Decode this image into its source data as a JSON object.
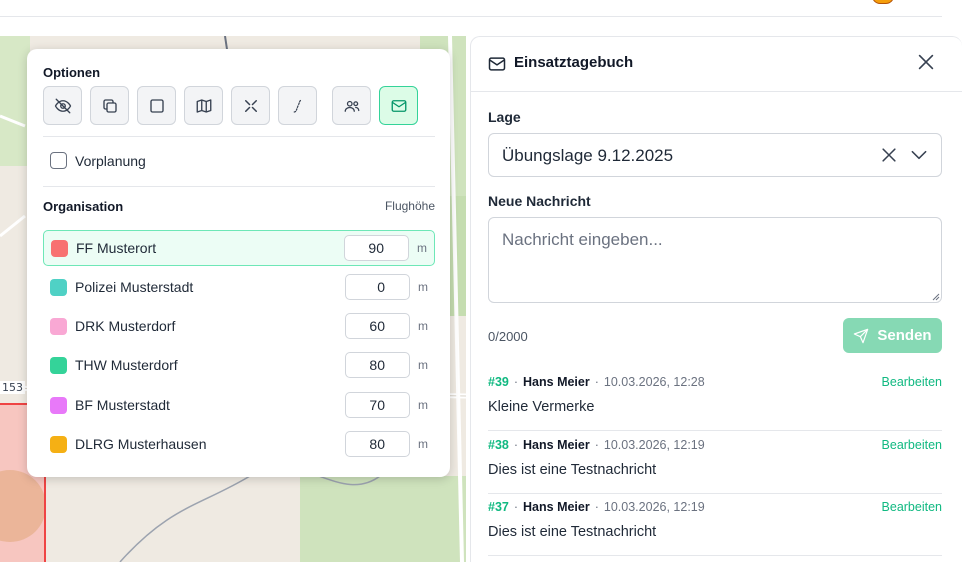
{
  "map": {
    "label": "153"
  },
  "options": {
    "title": "Optionen",
    "icons": [
      "eye-off-icon",
      "layers-icon",
      "square-icon",
      "map-icon",
      "crosshair-icon",
      "route-icon",
      "users-icon",
      "mail-icon"
    ],
    "active_icon": "mail-icon",
    "vorplanung_label": "Vorplanung",
    "vorplanung_checked": false,
    "org_title": "Organisation",
    "altitude_header": "Flughöhe",
    "unit": "m",
    "organizations": [
      {
        "name": "FF Musterort",
        "altitude": "90",
        "color": "#f87171",
        "selected": true
      },
      {
        "name": "Polizei Musterstadt",
        "altitude": "0",
        "color": "#4fd1c5",
        "selected": false
      },
      {
        "name": "DRK Musterdorf",
        "altitude": "60",
        "color": "#f9a8d4",
        "selected": false
      },
      {
        "name": "THW Musterdorf",
        "altitude": "80",
        "color": "#34d399",
        "selected": false
      },
      {
        "name": "BF Musterstadt",
        "altitude": "70",
        "color": "#e879f9",
        "selected": false
      },
      {
        "name": "DLRG Musterhausen",
        "altitude": "80",
        "color": "#f5b014",
        "selected": false
      }
    ]
  },
  "panel": {
    "title": "Einsatztagebuch",
    "lage_label": "Lage",
    "lage_value": "Übungslage 9.12.2025",
    "message_label": "Neue Nachricht",
    "message_placeholder": "Nachricht eingeben...",
    "counter": "0/2000",
    "send_label": "Senden",
    "accent": "#10b981",
    "messages": [
      {
        "num": "#39",
        "author": "Hans Meier",
        "time": "10.03.2026, 12:28",
        "edit": "Bearbeiten",
        "text": "Kleine Vermerke"
      },
      {
        "num": "#38",
        "author": "Hans Meier",
        "time": "10.03.2026, 12:19",
        "edit": "Bearbeiten",
        "text": "Dies ist eine Testnachricht"
      },
      {
        "num": "#37",
        "author": "Hans Meier",
        "time": "10.03.2026, 12:19",
        "edit": "Bearbeiten",
        "text": "Dies ist eine Testnachricht"
      }
    ]
  }
}
